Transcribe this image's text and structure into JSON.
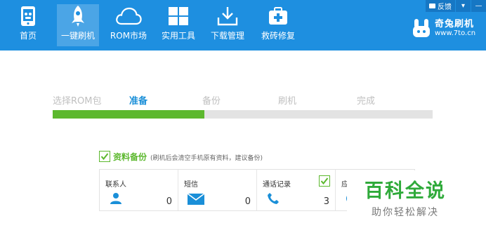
{
  "nav": {
    "items": [
      {
        "label": "首页",
        "icon": "phone-icon"
      },
      {
        "label": "一键刷机",
        "icon": "rocket-icon"
      },
      {
        "label": "ROM市场",
        "icon": "cloud-icon"
      },
      {
        "label": "实用工具",
        "icon": "grid-icon"
      },
      {
        "label": "下载管理",
        "icon": "download-icon"
      },
      {
        "label": "救砖修复",
        "icon": "medkit-icon"
      }
    ],
    "active_index": 1
  },
  "window": {
    "feedback_label": "反馈",
    "menu_glyph": "▾",
    "minimize_glyph": "—"
  },
  "brand": {
    "name": "奇兔刷机",
    "url": "www.7to.cn"
  },
  "steps": {
    "labels": [
      "选择ROM包",
      "准备",
      "备份",
      "刷机",
      "完成"
    ],
    "current_index": 1,
    "progress": 0.4
  },
  "backup": {
    "title": "资料备份",
    "note": "(刷机后会清空手机原有资料，建议备份)",
    "checked": true,
    "items": [
      {
        "label": "联系人",
        "value": "0",
        "icon": "contact-icon"
      },
      {
        "label": "短信",
        "value": "0",
        "icon": "envelope-icon"
      },
      {
        "label": "通话记录",
        "value": "3",
        "icon": "phone-handset-icon",
        "checked": true
      },
      {
        "label": "应",
        "icon": "app-icon"
      }
    ]
  },
  "watermark": {
    "title": "百科全说",
    "subtitle": "助你轻松解决"
  },
  "colors": {
    "topbar": "#1e8fe0",
    "accent": "#1a8fd8",
    "progress_fill": "#5cb82e",
    "track": "#e3e3e3",
    "check_green": "#5cb82e"
  }
}
